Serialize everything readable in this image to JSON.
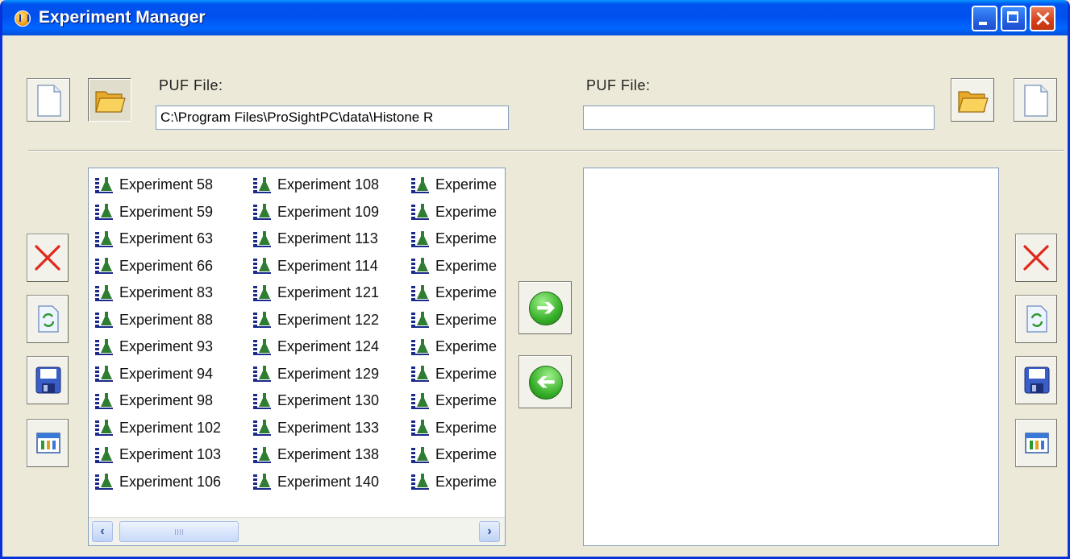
{
  "window": {
    "title": "Experiment Manager",
    "accent": "#0053EE",
    "background": "#ECE9D8"
  },
  "left": {
    "puf_label": "PUF File:",
    "puf_path": "C:\\Program Files\\ProSightPC\\data\\Histone R",
    "columns": [
      [
        "Experiment 58",
        "Experiment 59",
        "Experiment 63",
        "Experiment 66",
        "Experiment 83",
        "Experiment 88",
        "Experiment 93",
        "Experiment 94",
        "Experiment 98",
        "Experiment 102",
        "Experiment 103",
        "Experiment 106"
      ],
      [
        "Experiment 108",
        "Experiment 109",
        "Experiment 113",
        "Experiment 114",
        "Experiment 121",
        "Experiment 122",
        "Experiment 124",
        "Experiment 129",
        "Experiment 130",
        "Experiment 133",
        "Experiment 138",
        "Experiment 140"
      ],
      [
        "Experime",
        "Experime",
        "Experime",
        "Experime",
        "Experime",
        "Experime",
        "Experime",
        "Experime",
        "Experime",
        "Experime",
        "Experime",
        "Experime"
      ]
    ],
    "scrollbar_icons": {
      "left": "arrow-left-icon",
      "right": "arrow-right-icon"
    }
  },
  "right": {
    "puf_label": "PUF File:",
    "puf_path": ""
  },
  "icons": {
    "new": "new-document-icon",
    "open": "open-folder-icon",
    "delete": "delete-x-icon",
    "refresh": "refresh-document-icon",
    "save": "save-disk-icon",
    "table": "table-grid-icon",
    "move_right": "arrow-right-circle-icon",
    "move_left": "arrow-left-circle-icon"
  }
}
